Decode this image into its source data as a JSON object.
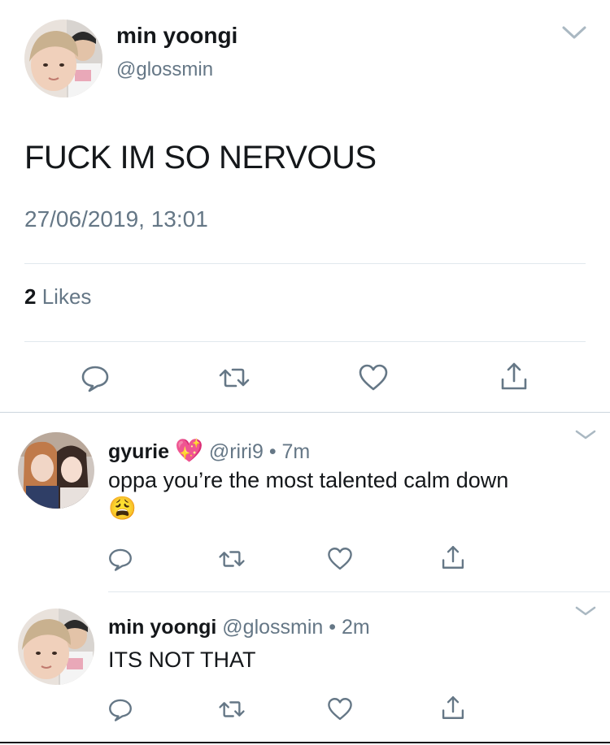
{
  "main_tweet": {
    "display_name": "min yoongi",
    "handle": "@glossmin",
    "text": "FUCK IM SO NERVOUS",
    "timestamp": "27/06/2019, 13:01",
    "likes_count": "2",
    "likes_label": "Likes"
  },
  "replies": [
    {
      "display_name": "gyurie",
      "badge": "💖",
      "handle": "@riri9",
      "separator": "•",
      "time": "7m",
      "text": "oppa you’re the most talented calm down",
      "emoji": "😩"
    },
    {
      "display_name": "min yoongi",
      "handle": "@glossmin",
      "separator": "•",
      "time": "2m",
      "text": "ITS NOT THAT"
    }
  ],
  "icons": {
    "reply": "speech-bubble-icon",
    "retweet": "retweet-arrows-icon",
    "like": "heart-icon",
    "share": "share-upload-icon",
    "menu": "chevron-down-icon"
  },
  "colors": {
    "text_primary": "#14171a",
    "text_secondary": "#657786",
    "divider": "#e1e8ed",
    "icon": "#657786"
  }
}
